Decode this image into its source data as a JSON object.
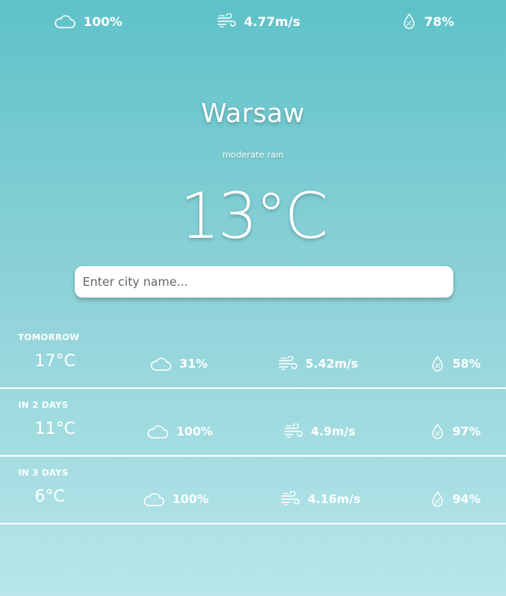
{
  "current": {
    "clouds": "100%",
    "wind": "4.77m/s",
    "humidity": "78%",
    "city": "Warsaw",
    "description": "moderate rain",
    "temperature": "13°C"
  },
  "search": {
    "placeholder": "Enter city name..."
  },
  "forecast": [
    {
      "label": "TOMORROW",
      "temperature": "17°C",
      "clouds": "31%",
      "wind": "5.42m/s",
      "humidity": "58%"
    },
    {
      "label": "IN 2 DAYS",
      "temperature": "11°C",
      "clouds": "100%",
      "wind": "4.9m/s",
      "humidity": "97%"
    },
    {
      "label": "IN 3 DAYS",
      "temperature": "6°C",
      "clouds": "100%",
      "wind": "4.16m/s",
      "humidity": "94%"
    }
  ],
  "icons": {
    "clouds": "cloud-icon",
    "wind": "wind-icon",
    "humidity": "humidity-drop-icon"
  },
  "colors": {
    "gradient_top": "#5ec2c8",
    "gradient_bottom": "#b8e6ea",
    "text": "#ffffff"
  }
}
